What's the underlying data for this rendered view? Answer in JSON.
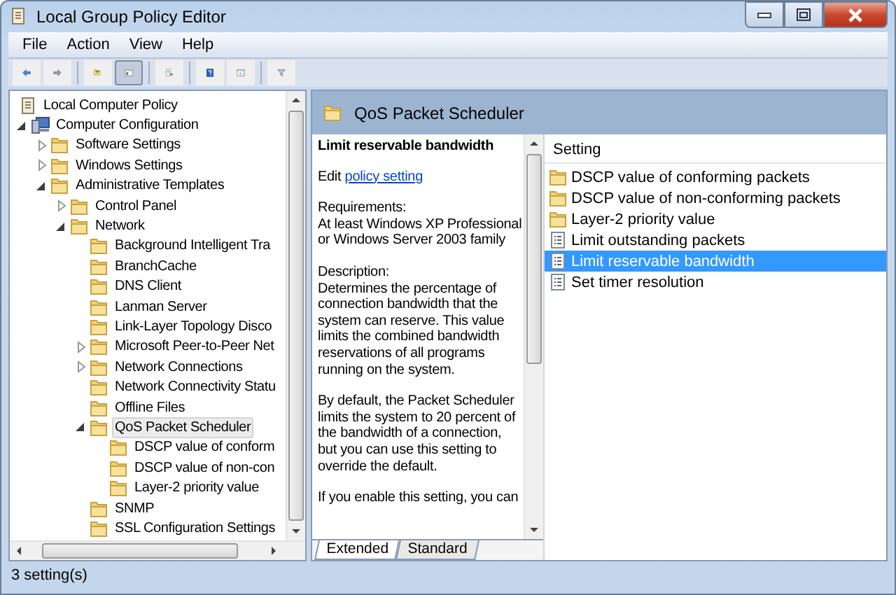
{
  "window": {
    "title": "Local Group Policy Editor"
  },
  "menu": [
    "File",
    "Action",
    "View",
    "Help"
  ],
  "toolbar": [
    [
      {
        "kind": "back",
        "pressed": false
      },
      {
        "kind": "forward",
        "pressed": false
      }
    ],
    [
      {
        "kind": "up",
        "pressed": false
      },
      {
        "kind": "tree",
        "pressed": true
      }
    ],
    [
      {
        "kind": "export",
        "pressed": false
      }
    ],
    [
      {
        "kind": "help",
        "pressed": false
      },
      {
        "kind": "pane",
        "pressed": false
      }
    ],
    [
      {
        "kind": "filter",
        "pressed": false
      }
    ]
  ],
  "tree": [
    {
      "label": "Local Computer Policy",
      "kind": "policy",
      "selected": false,
      "children": [
        {
          "label": "Computer Configuration",
          "kind": "computer",
          "expanded": true,
          "selected": false,
          "children": [
            {
              "label": "Software Settings",
              "kind": "folder",
              "expanded": false,
              "selected": false
            },
            {
              "label": "Windows Settings",
              "kind": "folder",
              "expanded": false,
              "selected": false
            },
            {
              "label": "Administrative Templates",
              "kind": "folder",
              "expanded": true,
              "selected": false,
              "children": [
                {
                  "label": "Control Panel",
                  "kind": "folder",
                  "expanded": false,
                  "selected": false
                },
                {
                  "label": "Network",
                  "kind": "folder",
                  "expanded": true,
                  "selected": false,
                  "children": [
                    {
                      "label": "Background Intelligent Tra",
                      "kind": "folder",
                      "selected": false
                    },
                    {
                      "label": "BranchCache",
                      "kind": "folder",
                      "selected": false
                    },
                    {
                      "label": "DNS Client",
                      "kind": "folder",
                      "selected": false
                    },
                    {
                      "label": "Lanman Server",
                      "kind": "folder",
                      "selected": false
                    },
                    {
                      "label": "Link-Layer Topology Disco",
                      "kind": "folder",
                      "selected": false
                    },
                    {
                      "label": "Microsoft Peer-to-Peer Net",
                      "kind": "folder",
                      "expanded": false,
                      "selected": false
                    },
                    {
                      "label": "Network Connections",
                      "kind": "folder",
                      "expanded": false,
                      "selected": false
                    },
                    {
                      "label": "Network Connectivity Statu",
                      "kind": "folder",
                      "selected": false
                    },
                    {
                      "label": "Offline Files",
                      "kind": "folder",
                      "selected": false
                    },
                    {
                      "label": "QoS Packet Scheduler",
                      "kind": "folder",
                      "expanded": true,
                      "selected": true,
                      "children": [
                        {
                          "label": "DSCP value of conform",
                          "kind": "folder",
                          "selected": false
                        },
                        {
                          "label": "DSCP value of non-con",
                          "kind": "folder",
                          "selected": false
                        },
                        {
                          "label": "Layer-2 priority value",
                          "kind": "folder",
                          "selected": false
                        }
                      ]
                    },
                    {
                      "label": "SNMP",
                      "kind": "folder",
                      "selected": false
                    },
                    {
                      "label": "SSL Configuration Settings",
                      "kind": "folder",
                      "selected": false
                    }
                  ]
                }
              ]
            }
          ]
        }
      ]
    }
  ],
  "header": {
    "title": "QoS Packet Scheduler"
  },
  "description": {
    "title": "Limit reservable bandwidth",
    "edit_prefix": "Edit",
    "edit_link": "policy setting",
    "requirements_label": "Requirements:",
    "requirements": "At least Windows XP Professional or Windows Server 2003 family",
    "description_label": "Description:",
    "paragraphs": [
      "Determines the percentage of connection bandwidth that the system can reserve. This value limits the combined bandwidth reservations of all programs running on the system.",
      "By default, the Packet Scheduler limits the system to 20 percent of the bandwidth of a connection, but you can use this setting to override the default.",
      "If you enable this setting, you can"
    ]
  },
  "list": {
    "column": "Setting",
    "rows": [
      {
        "label": "DSCP value of conforming packets",
        "kind": "folder",
        "selected": false
      },
      {
        "label": "DSCP value of non-conforming packets",
        "kind": "folder",
        "selected": false
      },
      {
        "label": "Layer-2 priority value",
        "kind": "folder",
        "selected": false
      },
      {
        "label": "Limit outstanding packets",
        "kind": "setting",
        "selected": false
      },
      {
        "label": "Limit reservable bandwidth",
        "kind": "setting",
        "selected": true
      },
      {
        "label": "Set timer resolution",
        "kind": "setting",
        "selected": false
      }
    ]
  },
  "tabs": [
    {
      "label": "Extended",
      "selected": true
    },
    {
      "label": "Standard",
      "selected": false
    }
  ],
  "status_bar": "3 setting(s)"
}
